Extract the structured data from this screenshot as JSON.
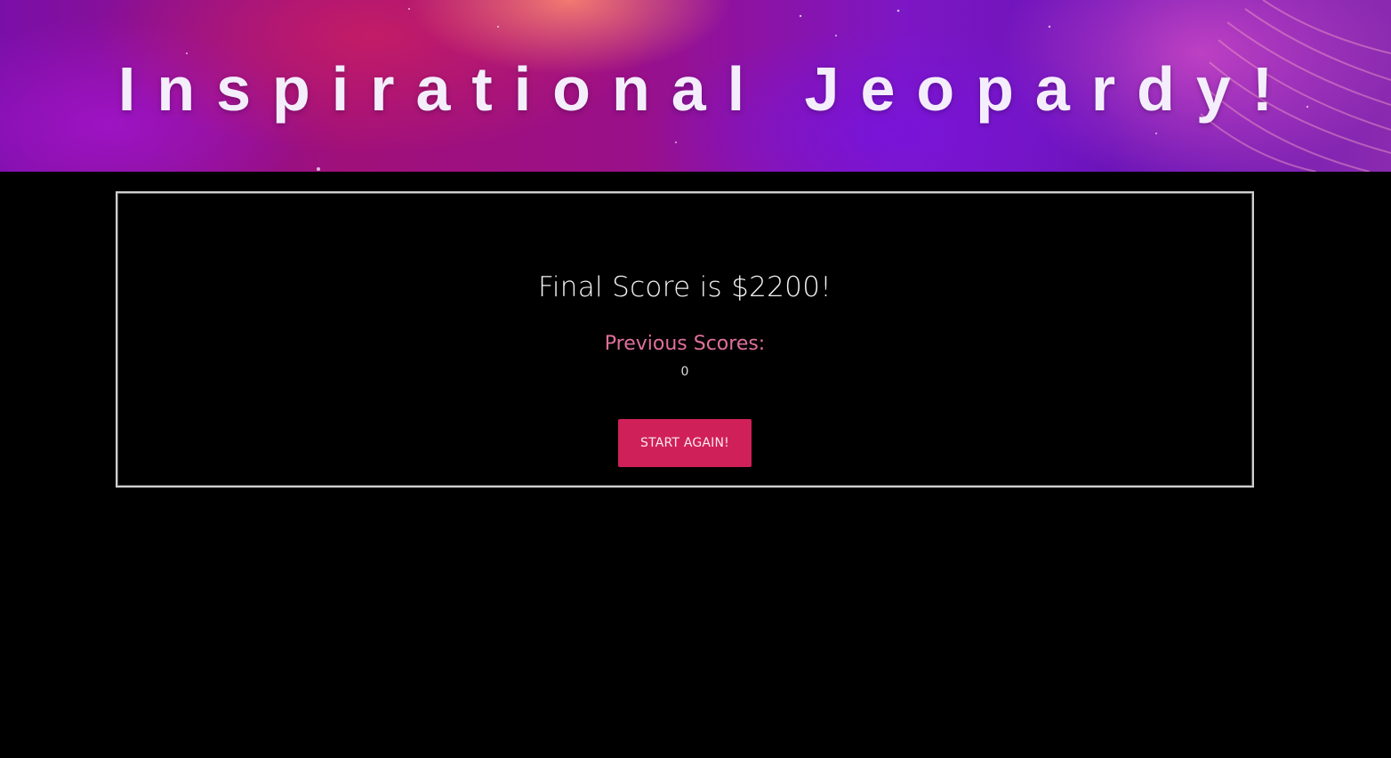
{
  "header": {
    "title": "Inspirational Jeopardy!"
  },
  "result": {
    "final_score_text": "Final Score is $2200!",
    "previous_scores_label": "Previous Scores:",
    "previous_scores": [
      "0"
    ],
    "restart_label": "START AGAIN!"
  },
  "colors": {
    "background": "#000000",
    "accent": "#d0205a",
    "previous_label": "#e0709a",
    "panel_border": "#cfcfcf"
  }
}
